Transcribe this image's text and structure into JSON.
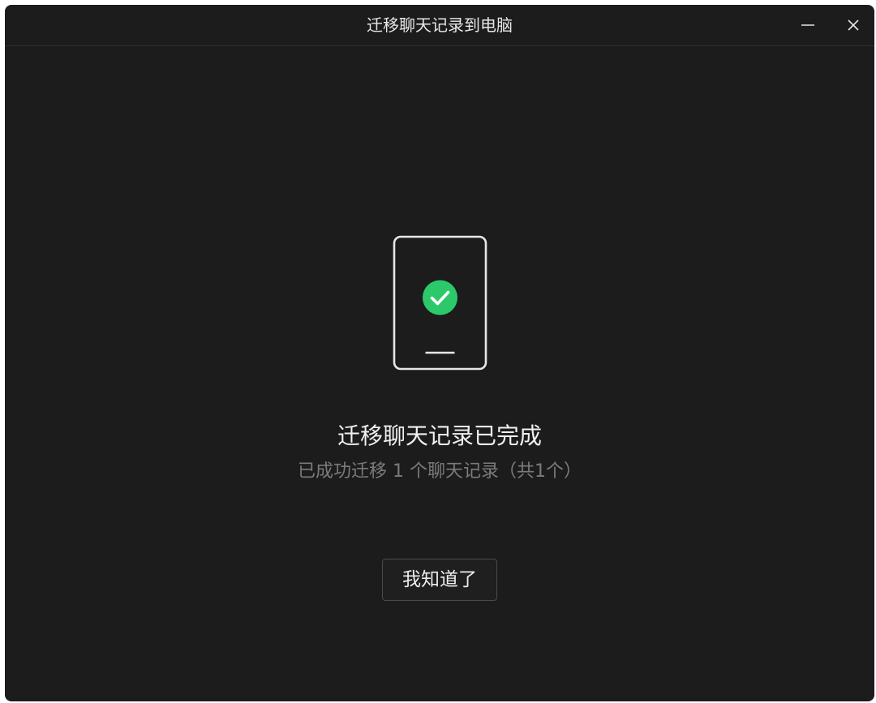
{
  "window": {
    "title": "迁移聊天记录到电脑"
  },
  "status": {
    "icon": "phone-with-check-icon",
    "heading": "迁移聊天记录已完成",
    "subtitle": "已成功迁移 1 个聊天记录（共1个）"
  },
  "actions": {
    "confirm_label": "我知道了"
  },
  "colors": {
    "background": "#1c1c1c",
    "success": "#2bc96a",
    "text_primary": "#f0f0f0",
    "text_secondary": "#7b7b7b"
  }
}
